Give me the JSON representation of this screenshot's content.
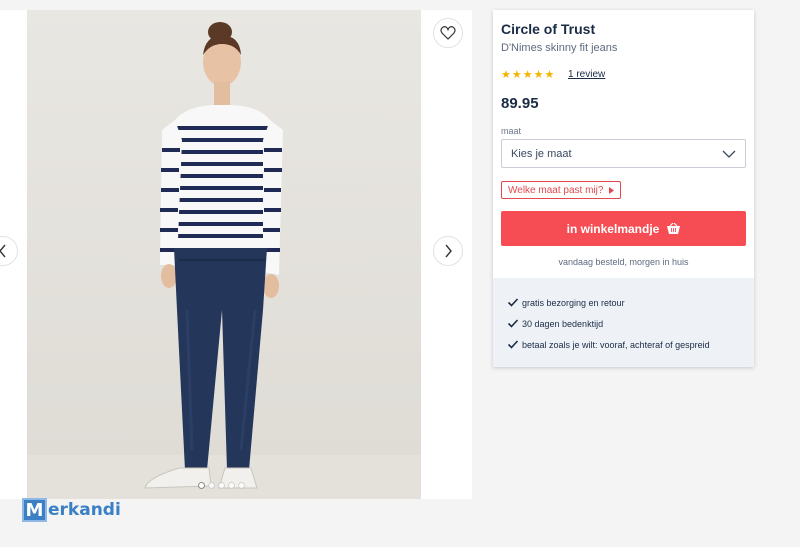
{
  "gallery": {
    "image_alt": "Model wearing striped top and skinny fit jeans",
    "dots_total": 5,
    "active_dot": 0
  },
  "product": {
    "brand": "Circle of Trust",
    "name": "D'Nimes skinny fit jeans",
    "rating_stars": 5,
    "review_text": "1 review",
    "price": "89.95"
  },
  "size": {
    "label": "maat",
    "placeholder": "Kies je maat",
    "help": "Welke maat past mij?"
  },
  "cart": {
    "button_label": "in winkelmandje",
    "delivery_note": "vandaag besteld, morgen in huis"
  },
  "usps": [
    {
      "text": "gratis bezorging en retour"
    },
    {
      "text": "30 dagen bedenktijd"
    },
    {
      "text": "betaal zoals je wilt: vooraf, achteraf of gespreid"
    }
  ],
  "watermark": {
    "initial": "M",
    "text": "erkandi"
  },
  "colors": {
    "accent": "#f54d53",
    "text": "#1a2b45",
    "star": "#f5b400",
    "usp_bg": "#eef2f6"
  },
  "icons": {
    "favorite": "heart-icon",
    "prev": "chevron-left-icon",
    "next": "chevron-right-icon",
    "select": "chevron-down-icon",
    "cart": "basket-icon",
    "usp": "check-icon"
  }
}
